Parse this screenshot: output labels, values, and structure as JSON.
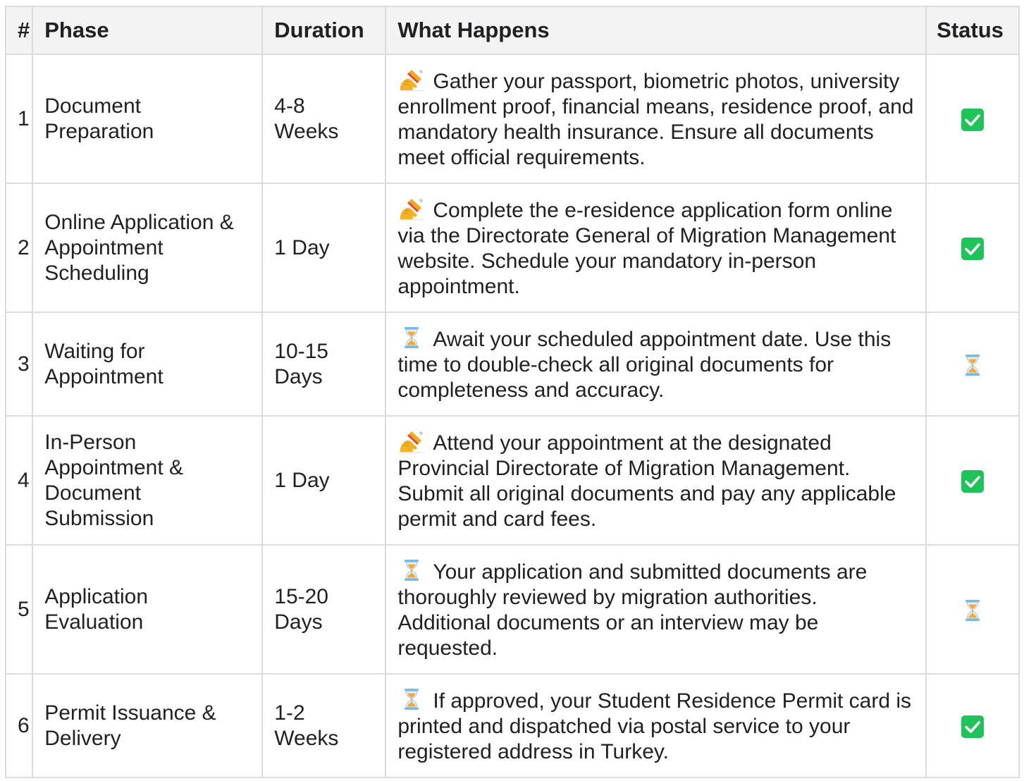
{
  "headers": {
    "num": "#",
    "phase": "Phase",
    "duration": "Duration",
    "what": "What Happens",
    "status": "Status"
  },
  "colors": {
    "check_green": "#1ec35a",
    "hourglass_frame": "#78b9e6",
    "hourglass_sand": "#f4a83a",
    "pencil": "#f5b228",
    "border": "#dcdcdc",
    "header_bg": "#f3f3f3"
  },
  "rows": [
    {
      "num": "1",
      "phase": "Document Preparation",
      "duration": "4-8 Weeks",
      "what_icon": "writing-hand-icon",
      "what": "Gather your passport, biometric photos, university enrollment proof, financial means, residence proof, and mandatory health insurance. Ensure all documents meet official requirements.",
      "status_icon": "check-mark-icon"
    },
    {
      "num": "2",
      "phase": "Online Application & Appointment Scheduling",
      "duration": "1 Day",
      "what_icon": "writing-hand-icon",
      "what": "Complete the e-residence application form online via the Directorate General of Migration Management website. Schedule your mandatory in-person appointment.",
      "status_icon": "check-mark-icon"
    },
    {
      "num": "3",
      "phase": "Waiting for Appointment",
      "duration": "10-15 Days",
      "what_icon": "hourglass-icon",
      "what": "Await your scheduled appointment date. Use this time to double-check all original documents for completeness and accuracy.",
      "status_icon": "hourglass-icon"
    },
    {
      "num": "4",
      "phase": "In-Person Appointment & Document Submission",
      "duration": "1 Day",
      "what_icon": "writing-hand-icon",
      "what": "Attend your appointment at the designated Provincial Directorate of Migration Management. Submit all original documents and pay any applicable permit and card fees.",
      "status_icon": "check-mark-icon"
    },
    {
      "num": "5",
      "phase": "Application Evaluation",
      "duration": "15-20 Days",
      "what_icon": "hourglass-icon",
      "what": "Your application and submitted documents are thoroughly reviewed by migration authorities. Additional documents or an interview may be requested.",
      "status_icon": "hourglass-icon"
    },
    {
      "num": "6",
      "phase": "Permit Issuance & Delivery",
      "duration": "1-2 Weeks",
      "what_icon": "hourglass-icon",
      "what": "If approved, your Student Residence Permit card is printed and dispatched via postal service to your registered address in Turkey.",
      "status_icon": "check-mark-icon"
    }
  ]
}
